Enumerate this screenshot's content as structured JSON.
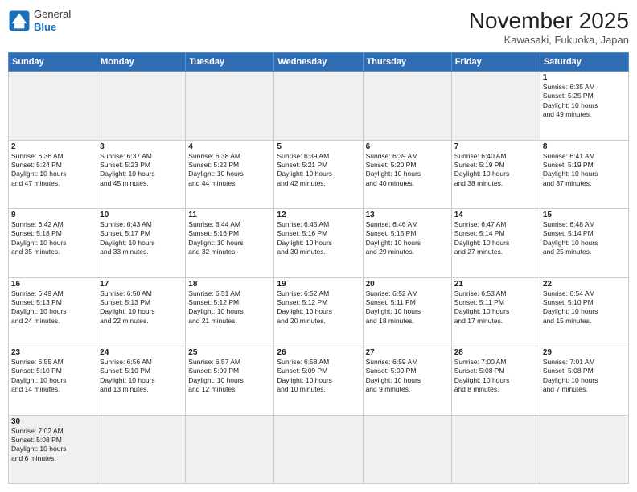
{
  "header": {
    "logo_general": "General",
    "logo_blue": "Blue",
    "title": "November 2025",
    "location": "Kawasaki, Fukuoka, Japan"
  },
  "weekdays": [
    "Sunday",
    "Monday",
    "Tuesday",
    "Wednesday",
    "Thursday",
    "Friday",
    "Saturday"
  ],
  "weeks": [
    [
      {
        "day": "",
        "info": ""
      },
      {
        "day": "",
        "info": ""
      },
      {
        "day": "",
        "info": ""
      },
      {
        "day": "",
        "info": ""
      },
      {
        "day": "",
        "info": ""
      },
      {
        "day": "",
        "info": ""
      },
      {
        "day": "1",
        "info": "Sunrise: 6:35 AM\nSunset: 5:25 PM\nDaylight: 10 hours\nand 49 minutes."
      }
    ],
    [
      {
        "day": "2",
        "info": "Sunrise: 6:36 AM\nSunset: 5:24 PM\nDaylight: 10 hours\nand 47 minutes."
      },
      {
        "day": "3",
        "info": "Sunrise: 6:37 AM\nSunset: 5:23 PM\nDaylight: 10 hours\nand 45 minutes."
      },
      {
        "day": "4",
        "info": "Sunrise: 6:38 AM\nSunset: 5:22 PM\nDaylight: 10 hours\nand 44 minutes."
      },
      {
        "day": "5",
        "info": "Sunrise: 6:39 AM\nSunset: 5:21 PM\nDaylight: 10 hours\nand 42 minutes."
      },
      {
        "day": "6",
        "info": "Sunrise: 6:39 AM\nSunset: 5:20 PM\nDaylight: 10 hours\nand 40 minutes."
      },
      {
        "day": "7",
        "info": "Sunrise: 6:40 AM\nSunset: 5:19 PM\nDaylight: 10 hours\nand 38 minutes."
      },
      {
        "day": "8",
        "info": "Sunrise: 6:41 AM\nSunset: 5:19 PM\nDaylight: 10 hours\nand 37 minutes."
      }
    ],
    [
      {
        "day": "9",
        "info": "Sunrise: 6:42 AM\nSunset: 5:18 PM\nDaylight: 10 hours\nand 35 minutes."
      },
      {
        "day": "10",
        "info": "Sunrise: 6:43 AM\nSunset: 5:17 PM\nDaylight: 10 hours\nand 33 minutes."
      },
      {
        "day": "11",
        "info": "Sunrise: 6:44 AM\nSunset: 5:16 PM\nDaylight: 10 hours\nand 32 minutes."
      },
      {
        "day": "12",
        "info": "Sunrise: 6:45 AM\nSunset: 5:16 PM\nDaylight: 10 hours\nand 30 minutes."
      },
      {
        "day": "13",
        "info": "Sunrise: 6:46 AM\nSunset: 5:15 PM\nDaylight: 10 hours\nand 29 minutes."
      },
      {
        "day": "14",
        "info": "Sunrise: 6:47 AM\nSunset: 5:14 PM\nDaylight: 10 hours\nand 27 minutes."
      },
      {
        "day": "15",
        "info": "Sunrise: 6:48 AM\nSunset: 5:14 PM\nDaylight: 10 hours\nand 25 minutes."
      }
    ],
    [
      {
        "day": "16",
        "info": "Sunrise: 6:49 AM\nSunset: 5:13 PM\nDaylight: 10 hours\nand 24 minutes."
      },
      {
        "day": "17",
        "info": "Sunrise: 6:50 AM\nSunset: 5:13 PM\nDaylight: 10 hours\nand 22 minutes."
      },
      {
        "day": "18",
        "info": "Sunrise: 6:51 AM\nSunset: 5:12 PM\nDaylight: 10 hours\nand 21 minutes."
      },
      {
        "day": "19",
        "info": "Sunrise: 6:52 AM\nSunset: 5:12 PM\nDaylight: 10 hours\nand 20 minutes."
      },
      {
        "day": "20",
        "info": "Sunrise: 6:52 AM\nSunset: 5:11 PM\nDaylight: 10 hours\nand 18 minutes."
      },
      {
        "day": "21",
        "info": "Sunrise: 6:53 AM\nSunset: 5:11 PM\nDaylight: 10 hours\nand 17 minutes."
      },
      {
        "day": "22",
        "info": "Sunrise: 6:54 AM\nSunset: 5:10 PM\nDaylight: 10 hours\nand 15 minutes."
      }
    ],
    [
      {
        "day": "23",
        "info": "Sunrise: 6:55 AM\nSunset: 5:10 PM\nDaylight: 10 hours\nand 14 minutes."
      },
      {
        "day": "24",
        "info": "Sunrise: 6:56 AM\nSunset: 5:10 PM\nDaylight: 10 hours\nand 13 minutes."
      },
      {
        "day": "25",
        "info": "Sunrise: 6:57 AM\nSunset: 5:09 PM\nDaylight: 10 hours\nand 12 minutes."
      },
      {
        "day": "26",
        "info": "Sunrise: 6:58 AM\nSunset: 5:09 PM\nDaylight: 10 hours\nand 10 minutes."
      },
      {
        "day": "27",
        "info": "Sunrise: 6:59 AM\nSunset: 5:09 PM\nDaylight: 10 hours\nand 9 minutes."
      },
      {
        "day": "28",
        "info": "Sunrise: 7:00 AM\nSunset: 5:08 PM\nDaylight: 10 hours\nand 8 minutes."
      },
      {
        "day": "29",
        "info": "Sunrise: 7:01 AM\nSunset: 5:08 PM\nDaylight: 10 hours\nand 7 minutes."
      }
    ],
    [
      {
        "day": "30",
        "info": "Sunrise: 7:02 AM\nSunset: 5:08 PM\nDaylight: 10 hours\nand 6 minutes."
      },
      {
        "day": "",
        "info": ""
      },
      {
        "day": "",
        "info": ""
      },
      {
        "day": "",
        "info": ""
      },
      {
        "day": "",
        "info": ""
      },
      {
        "day": "",
        "info": ""
      },
      {
        "day": "",
        "info": ""
      }
    ]
  ]
}
